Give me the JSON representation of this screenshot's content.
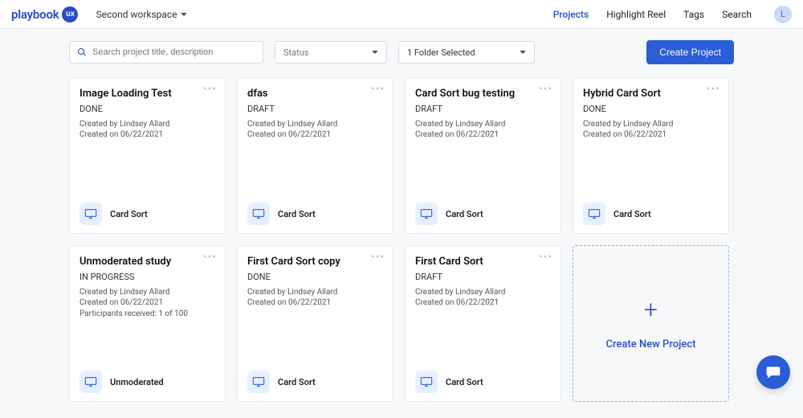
{
  "brand": {
    "word": "playbook",
    "badge": "ux"
  },
  "workspace": {
    "label": "Second workspace"
  },
  "nav": {
    "projects": "Projects",
    "highlight": "Highlight Reel",
    "tags": "Tags",
    "search": "Search"
  },
  "avatar": {
    "initial": "L"
  },
  "toolbar": {
    "search_placeholder": "Search project title, description",
    "status_label": "Status",
    "folder_label": "1 Folder Selected",
    "create_btn": "Create Project"
  },
  "create_new_label": "Create New Project",
  "type_labels": {
    "card_sort": "Card Sort",
    "unmoderated": "Unmoderated"
  },
  "projects": [
    {
      "title": "Image Loading Test",
      "status": "DONE",
      "creator": "Created by Lindsey Allard",
      "created_on": "Created on 06/22/2021",
      "extra": "",
      "type": "card_sort"
    },
    {
      "title": "dfas",
      "status": "DRAFT",
      "creator": "Created by Lindsey Allard",
      "created_on": "Created on 06/22/2021",
      "extra": "",
      "type": "card_sort"
    },
    {
      "title": "Card Sort bug testing",
      "status": "DRAFT",
      "creator": "Created by Lindsey Allard",
      "created_on": "Created on 06/22/2021",
      "extra": "",
      "type": "card_sort"
    },
    {
      "title": "Hybrid Card Sort",
      "status": "DONE",
      "creator": "Created by Lindsey Allard",
      "created_on": "Created on 06/22/2021",
      "extra": "",
      "type": "card_sort"
    },
    {
      "title": "Unmoderated study",
      "status": "IN PROGRESS",
      "creator": "Created by Lindsey Allard",
      "created_on": "Created on 06/22/2021",
      "extra": "Participants received: 1 of 100",
      "type": "unmoderated"
    },
    {
      "title": "First Card Sort copy",
      "status": "DONE",
      "creator": "Created by Lindsey Allard",
      "created_on": "Created on 06/22/2021",
      "extra": "",
      "type": "card_sort"
    },
    {
      "title": "First Card Sort",
      "status": "DRAFT",
      "creator": "Created by Lindsey Allard",
      "created_on": "Created on 06/22/2021",
      "extra": "",
      "type": "card_sort"
    }
  ]
}
